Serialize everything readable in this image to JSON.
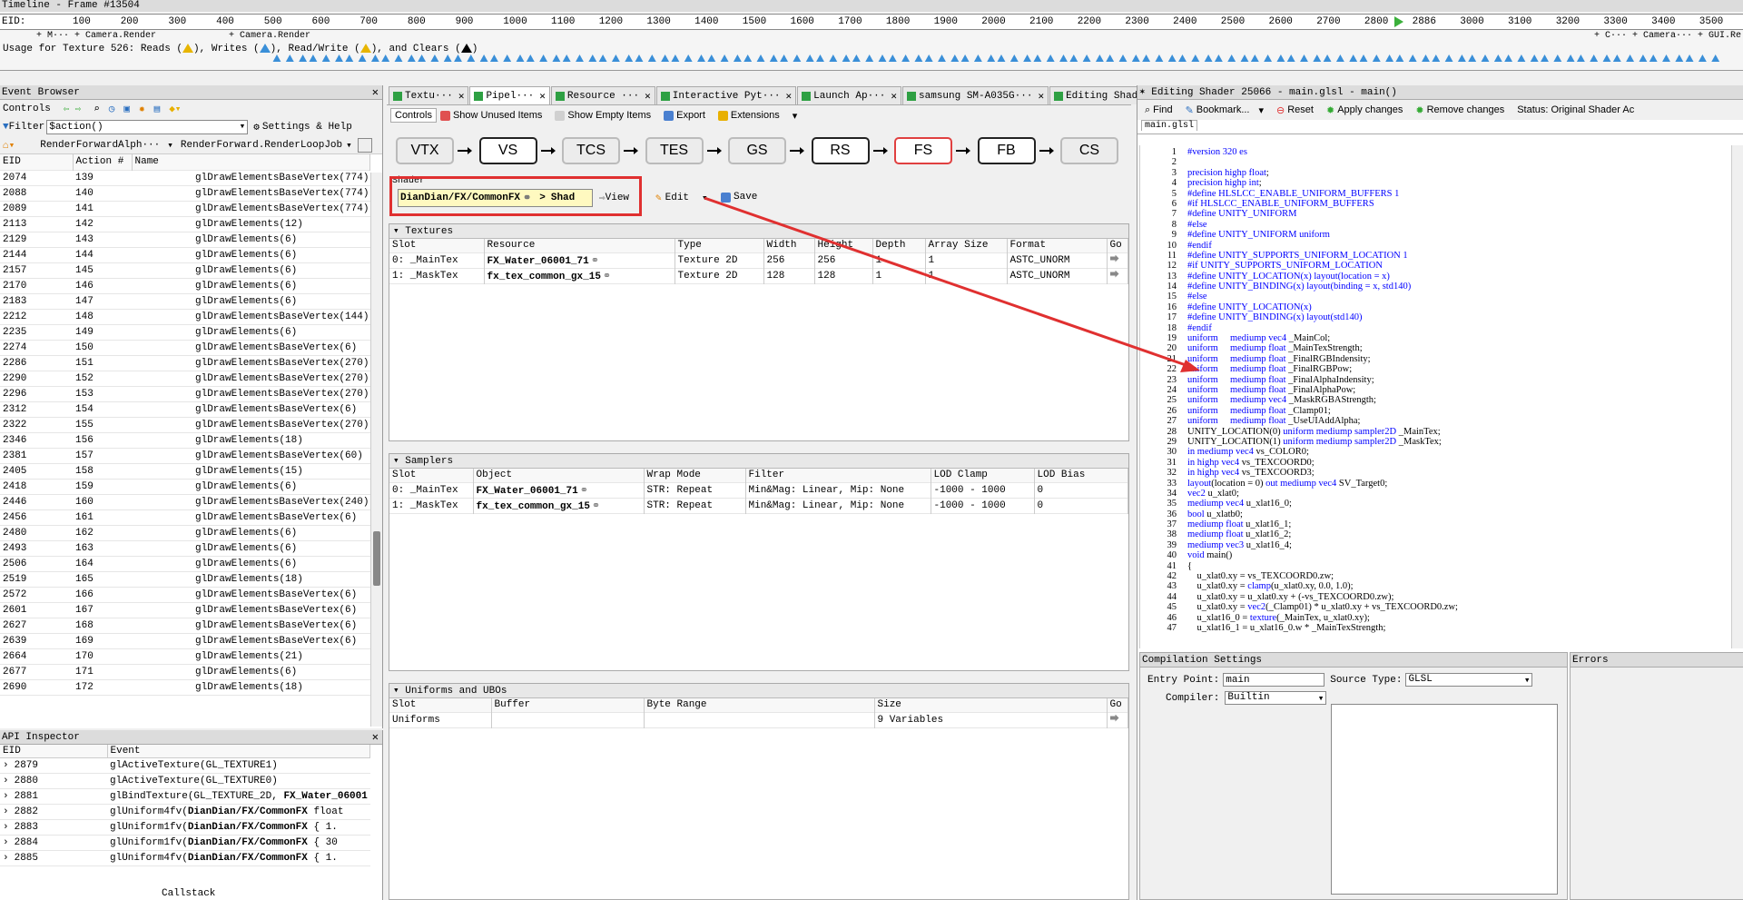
{
  "timeline": {
    "title": "Timeline - Frame #13504",
    "eid_label": "EID:",
    "ticks": [
      "100",
      "200",
      "300",
      "400",
      "500",
      "600",
      "700",
      "800",
      "900",
      "1000",
      "1100",
      "1200",
      "1300",
      "1400",
      "1500",
      "1600",
      "1700",
      "1800",
      "1900",
      "2000",
      "2100",
      "2200",
      "2300",
      "2400",
      "2500",
      "2600",
      "2700",
      "2800",
      "2886",
      "3000",
      "3100",
      "3200",
      "3300",
      "3400",
      "3500"
    ],
    "markers_left": "+ M···  + Camera.Render",
    "markers_mid": "+ Camera.Render",
    "markers_right": "+ C···  + Camera···  + GUI.Re",
    "usage_prefix": "Usage for Texture 526: Reads (",
    "usage_reads_end": "), Writes (",
    "usage_writes_end": "), Read/Write (",
    "usage_rw_end": "), and Clears (",
    "usage_clears_end": ")"
  },
  "event_browser": {
    "title": "Event Browser",
    "controls_label": "Controls",
    "filter_label": "Filter",
    "filter_value": "$action()",
    "settings_label": "Settings & Help",
    "breadcrumb_1": "RenderForwardAlph···",
    "breadcrumb_2": "RenderForward.RenderLoopJob",
    "columns": [
      "EID",
      "Action #",
      "Name"
    ],
    "rows": [
      [
        "2074",
        "139",
        "glDrawElementsBaseVertex(774)"
      ],
      [
        "2088",
        "140",
        "glDrawElementsBaseVertex(774)"
      ],
      [
        "2089",
        "141",
        "glDrawElementsBaseVertex(774)"
      ],
      [
        "2113",
        "142",
        "glDrawElements(12)"
      ],
      [
        "2129",
        "143",
        "glDrawElements(6)"
      ],
      [
        "2144",
        "144",
        "glDrawElements(6)"
      ],
      [
        "2157",
        "145",
        "glDrawElements(6)"
      ],
      [
        "2170",
        "146",
        "glDrawElements(6)"
      ],
      [
        "2183",
        "147",
        "glDrawElements(6)"
      ],
      [
        "2212",
        "148",
        "glDrawElementsBaseVertex(144)"
      ],
      [
        "2235",
        "149",
        "glDrawElements(6)"
      ],
      [
        "2274",
        "150",
        "glDrawElementsBaseVertex(6)"
      ],
      [
        "2286",
        "151",
        "glDrawElementsBaseVertex(270)"
      ],
      [
        "2290",
        "152",
        "glDrawElementsBaseVertex(270)"
      ],
      [
        "2296",
        "153",
        "glDrawElementsBaseVertex(270)"
      ],
      [
        "2312",
        "154",
        "glDrawElementsBaseVertex(6)"
      ],
      [
        "2322",
        "155",
        "glDrawElementsBaseVertex(270)"
      ],
      [
        "2346",
        "156",
        "glDrawElements(18)"
      ],
      [
        "2381",
        "157",
        "glDrawElementsBaseVertex(60)"
      ],
      [
        "2405",
        "158",
        "glDrawElements(15)"
      ],
      [
        "2418",
        "159",
        "glDrawElements(6)"
      ],
      [
        "2446",
        "160",
        "glDrawElementsBaseVertex(240)"
      ],
      [
        "2456",
        "161",
        "glDrawElementsBaseVertex(6)"
      ],
      [
        "2480",
        "162",
        "glDrawElements(6)"
      ],
      [
        "2493",
        "163",
        "glDrawElements(6)"
      ],
      [
        "2506",
        "164",
        "glDrawElements(6)"
      ],
      [
        "2519",
        "165",
        "glDrawElements(18)"
      ],
      [
        "2572",
        "166",
        "glDrawElementsBaseVertex(6)"
      ],
      [
        "2601",
        "167",
        "glDrawElementsBaseVertex(6)"
      ],
      [
        "2627",
        "168",
        "glDrawElementsBaseVertex(6)"
      ],
      [
        "2639",
        "169",
        "glDrawElementsBaseVertex(6)"
      ],
      [
        "2664",
        "170",
        "glDrawElements(21)"
      ],
      [
        "2677",
        "171",
        "glDrawElements(6)"
      ],
      [
        "2690",
        "172",
        "glDrawElements(18)"
      ]
    ]
  },
  "api_inspector": {
    "title": "API Inspector",
    "columns": [
      "EID",
      "Event"
    ],
    "rows": [
      [
        "2879",
        "glActiveTexture(GL_TEXTURE1)",
        ""
      ],
      [
        "2880",
        "glActiveTexture(GL_TEXTURE0)",
        ""
      ],
      [
        "2881",
        "glBindTexture(GL_TEXTURE_2D, ",
        "FX_Water_06001"
      ],
      [
        "2882",
        "glUniform4fv(",
        "DianDian/FX/CommonFX"
      ],
      [
        "2883",
        "glUniform1fv(",
        "DianDian/FX/CommonFX"
      ],
      [
        "2884",
        "glUniform1fv(",
        "DianDian/FX/CommonFX"
      ],
      [
        "2885",
        "glUniform4fv(",
        "DianDian/FX/CommonFX"
      ]
    ],
    "row_suffixes": [
      "",
      "",
      "",
      "  float",
      "  {  1.",
      "  {  30",
      "  {  1."
    ],
    "callstack_label": "Callstack"
  },
  "pipeline": {
    "tabs": [
      "Textu···",
      "Pipel···",
      "Resource ···",
      "Interactive Pyt···",
      "Launch Ap···",
      "samsung SM-A035G···",
      "Editing Shader···"
    ],
    "toolbar": {
      "controls": "Controls",
      "show_unused": "Show Unused Items",
      "show_empty": "Show Empty Items",
      "export": "Export",
      "extensions": "Extensions"
    },
    "stages": [
      "VTX",
      "VS",
      "TCS",
      "TES",
      "GS",
      "RS",
      "FS",
      "FB",
      "CS"
    ],
    "shader_label": "Shader",
    "shader_name": "DianDian/FX/CommonFX",
    "shader_sep": ">",
    "shader_tail": "Shad",
    "view_label": "View",
    "edit_label": "Edit",
    "save_label": "Save",
    "textures": {
      "title": "Textures",
      "columns": [
        "Slot",
        "Resource",
        "Type",
        "Width",
        "Height",
        "Depth",
        "Array Size",
        "Format",
        "Go"
      ],
      "rows": [
        [
          "0: _MainTex",
          "FX_Water_06001_71",
          "Texture 2D",
          "256",
          "256",
          "1",
          "1",
          "ASTC_UNORM"
        ],
        [
          "1: _MaskTex",
          "fx_tex_common_gx_15",
          "Texture 2D",
          "128",
          "128",
          "1",
          "1",
          "ASTC_UNORM"
        ]
      ]
    },
    "samplers": {
      "title": "Samplers",
      "columns": [
        "Slot",
        "Object",
        "Wrap Mode",
        "Filter",
        "LOD Clamp",
        "LOD Bias"
      ],
      "rows": [
        [
          "0: _MainTex",
          "FX_Water_06001_71",
          "STR: Repeat",
          "Min&Mag: Linear, Mip: None",
          "-1000 - 1000",
          "0"
        ],
        [
          "1: _MaskTex",
          "fx_tex_common_gx_15",
          "STR: Repeat",
          "Min&Mag: Linear, Mip: None",
          "-1000 - 1000",
          "0"
        ]
      ]
    },
    "uniforms": {
      "title": "Uniforms and UBOs",
      "columns": [
        "Slot",
        "Buffer",
        "Byte Range",
        "Size",
        "Go"
      ],
      "rows": [
        [
          "Uniforms",
          "",
          "",
          "9 Variables"
        ]
      ]
    }
  },
  "shader_editor": {
    "title": "Editing Shader 25066 - main.glsl - main()",
    "find": "Find",
    "bookmark": "Bookmark...",
    "reset": "Reset",
    "apply": "Apply changes",
    "remove": "Remove changes",
    "status": "Status: Original Shader Ac",
    "file_tab": "main.glsl",
    "code": [
      "#version 320 es",
      "",
      "precision highp float;",
      "precision highp int;",
      "#define HLSLCC_ENABLE_UNIFORM_BUFFERS 1",
      "#if HLSLCC_ENABLE_UNIFORM_BUFFERS",
      "#define UNITY_UNIFORM",
      "#else",
      "#define UNITY_UNIFORM uniform",
      "#endif",
      "#define UNITY_SUPPORTS_UNIFORM_LOCATION 1",
      "#if UNITY_SUPPORTS_UNIFORM_LOCATION",
      "#define UNITY_LOCATION(x) layout(location = x)",
      "#define UNITY_BINDING(x) layout(binding = x, std140)",
      "#else",
      "#define UNITY_LOCATION(x)",
      "#define UNITY_BINDING(x) layout(std140)",
      "#endif",
      "uniform     mediump vec4 _MainCol;",
      "uniform     mediump float _MainTexStrength;",
      "uniform     mediump float _FinalRGBIndensity;",
      "uniform     mediump float _FinalRGBPow;",
      "uniform     mediump float _FinalAlphaIndensity;",
      "uniform     mediump float _FinalAlphaPow;",
      "uniform     mediump vec4 _MaskRGBAStrength;",
      "uniform     mediump float _Clamp01;",
      "uniform     mediump float _UseUIAddAlpha;",
      "UNITY_LOCATION(0) uniform mediump sampler2D _MainTex;",
      "UNITY_LOCATION(1) uniform mediump sampler2D _MaskTex;",
      "in mediump vec4 vs_COLOR0;",
      "in highp vec4 vs_TEXCOORD0;",
      "in highp vec4 vs_TEXCOORD3;",
      "layout(location = 0) out mediump vec4 SV_Target0;",
      "vec2 u_xlat0;",
      "mediump vec4 u_xlat16_0;",
      "bool u_xlatb0;",
      "mediump float u_xlat16_1;",
      "mediump float u_xlat16_2;",
      "mediump vec3 u_xlat16_4;",
      "void main()",
      "{",
      "    u_xlat0.xy = vs_TEXCOORD0.zw;",
      "    u_xlat0.xy = clamp(u_xlat0.xy, 0.0, 1.0);",
      "    u_xlat0.xy = u_xlat0.xy + (-vs_TEXCOORD0.zw);",
      "    u_xlat0.xy = vec2(_Clamp01) * u_xlat0.xy + vs_TEXCOORD0.zw;",
      "    u_xlat16_0 = texture(_MainTex, u_xlat0.xy);",
      "    u_xlat16_1 = u_xlat16_0.w * _MainTexStrength;"
    ],
    "compilation": {
      "title": "Compilation Settings",
      "entry_label": "Entry Point:",
      "entry_value": "main",
      "source_label": "Source Type:",
      "source_value": "GLSL",
      "compiler_label": "Compiler:",
      "compiler_value": "Builtin"
    },
    "errors_title": "Errors"
  },
  "colors": {
    "highlight_red": "#e03030",
    "keyword_blue": "#0000ff",
    "tab_green": "#2ea043"
  }
}
